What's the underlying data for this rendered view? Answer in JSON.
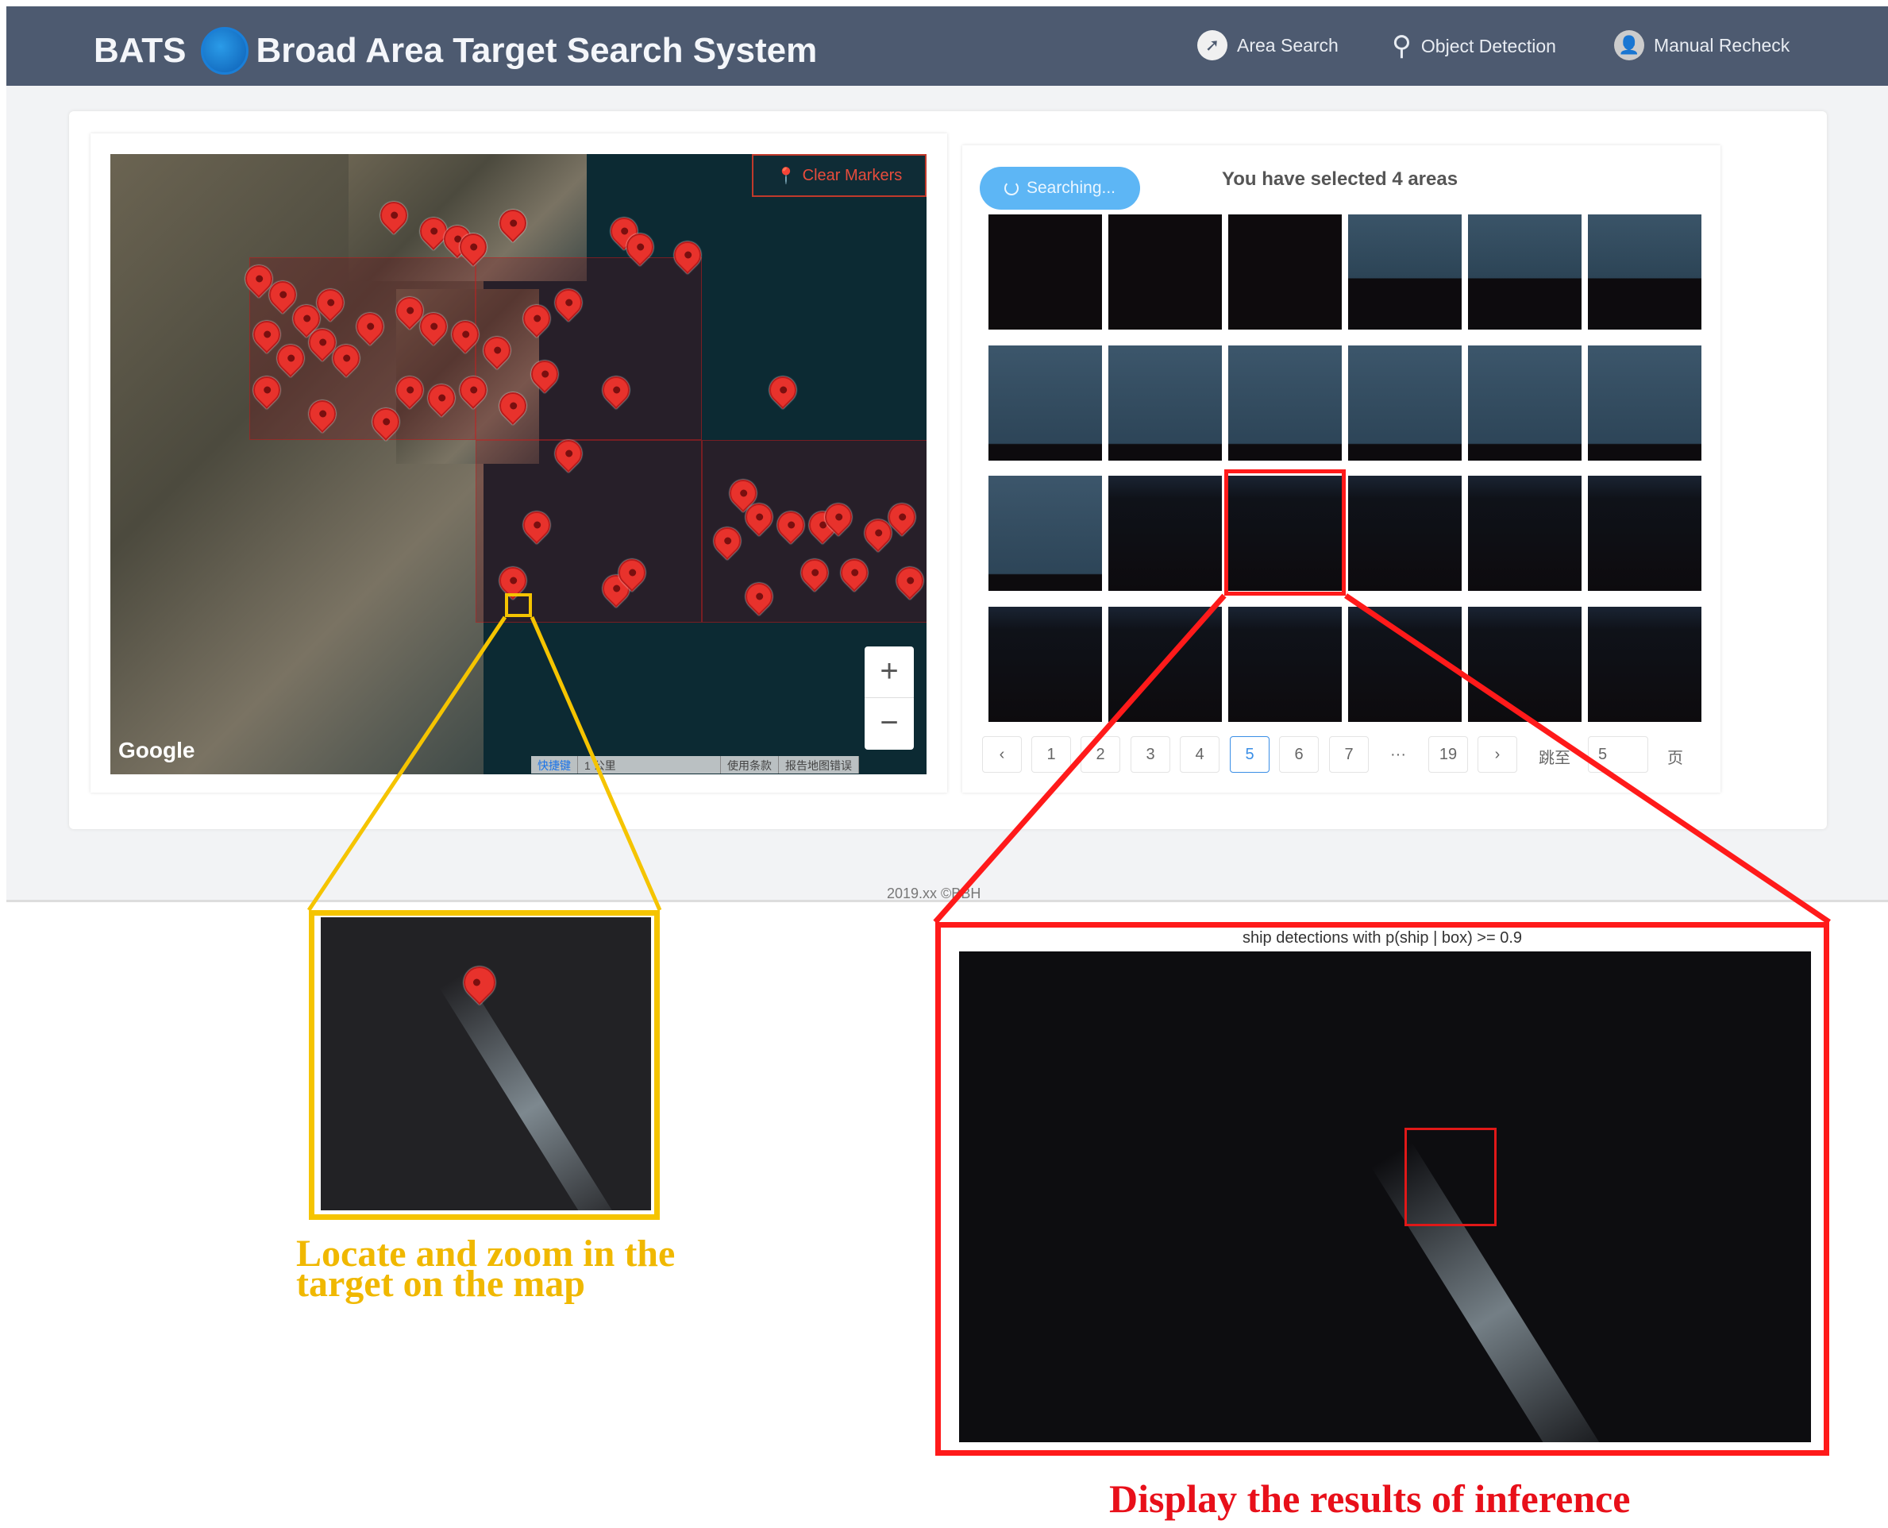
{
  "header": {
    "app_short": "BATS",
    "app_title": "Broad Area Target Search System",
    "nav": [
      {
        "label": "Area Search",
        "icon": "compass-icon"
      },
      {
        "label": "Object Detection",
        "icon": "search-icon"
      },
      {
        "label": "Manual Recheck",
        "icon": "user-icon"
      }
    ]
  },
  "map": {
    "clear_markers": "Clear Markers",
    "zoom_in": "+",
    "zoom_out": "−",
    "google": "Google",
    "footer": [
      "快捷键",
      "1 公里",
      "使用条款",
      "报告地图错误"
    ]
  },
  "results": {
    "searching": "Searching...",
    "selected_text": "You have selected 4 areas",
    "pagination": {
      "prev": "‹",
      "pages": [
        "1",
        "2",
        "3",
        "4",
        "5",
        "6",
        "7"
      ],
      "ellipsis": "···",
      "last": "19",
      "next": "›",
      "current": "5",
      "jump_label": "跳至",
      "jump_value": "5",
      "page_suffix": "页"
    }
  },
  "footer": {
    "text": "2019.xx ©BBH"
  },
  "zoom_callout": {
    "caption_line1": "Locate and zoom in the",
    "caption_line2": "target  on the map"
  },
  "inference_callout": {
    "title": "ship detections with p(ship | box) >= 0.9",
    "caption": "Display the results of inference"
  },
  "colors": {
    "header": "#4d5a70",
    "accent": "#3a8ee6",
    "marker": "#e8322c",
    "callout_yellow": "#f5c400",
    "callout_red": "#ff1a1a"
  }
}
